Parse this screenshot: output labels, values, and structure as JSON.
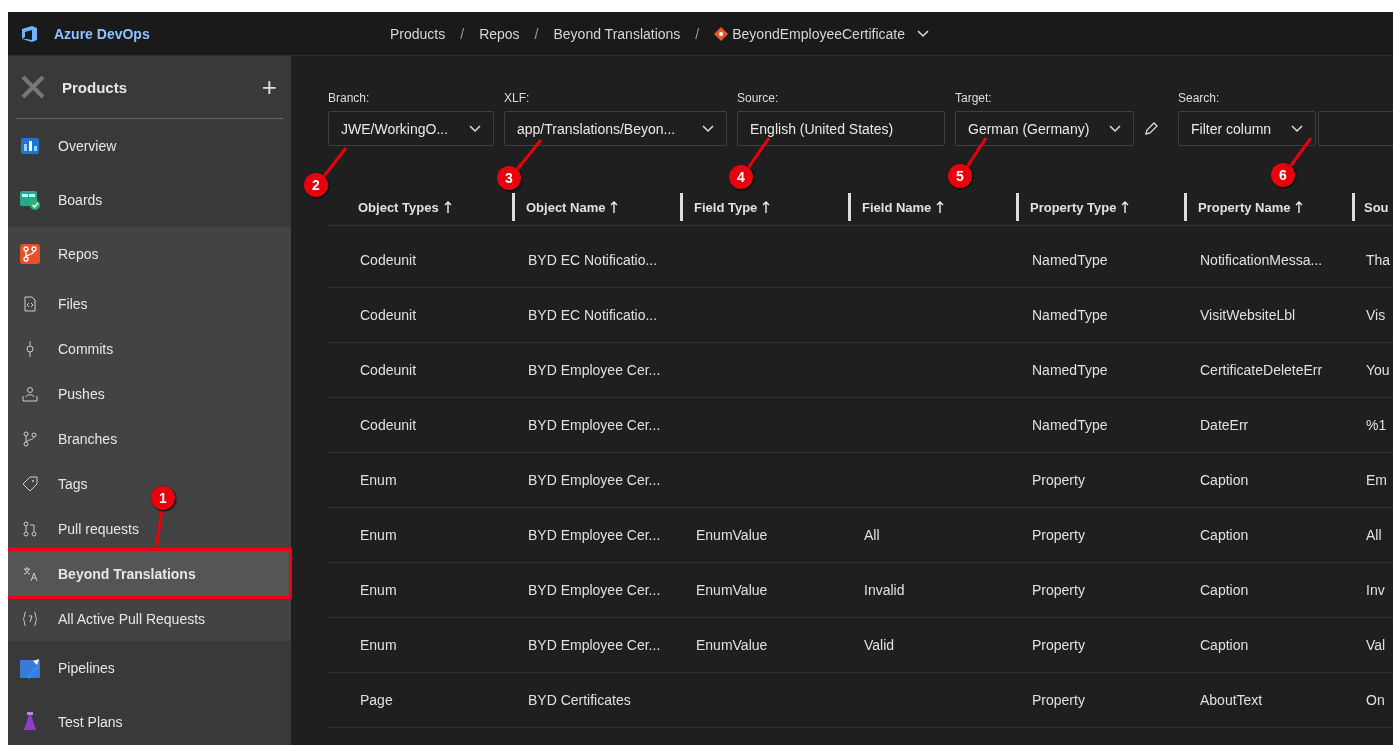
{
  "topbar": {
    "product": "Azure DevOps",
    "separator": "/",
    "breadcrumb": [
      {
        "label": "Products",
        "kind": "text"
      },
      {
        "label": "Repos",
        "kind": "text"
      },
      {
        "label": "Beyond Translations",
        "kind": "text"
      },
      {
        "label": "BeyondEmployeeCertificate",
        "kind": "repo"
      }
    ]
  },
  "sidebar": {
    "project": "Products",
    "add_label": "+",
    "items": [
      {
        "label": "Overview",
        "selected": false
      },
      {
        "label": "Boards",
        "selected": false
      },
      {
        "label": "Repos",
        "selected": false,
        "expanded": true,
        "children": [
          {
            "label": "Files",
            "selected": false,
            "highlighted": false
          },
          {
            "label": "Commits",
            "selected": false,
            "highlighted": false
          },
          {
            "label": "Pushes",
            "selected": false,
            "highlighted": false
          },
          {
            "label": "Branches",
            "selected": false,
            "highlighted": false
          },
          {
            "label": "Tags",
            "selected": false,
            "highlighted": false
          },
          {
            "label": "Pull requests",
            "selected": false,
            "highlighted": false
          },
          {
            "label": "Beyond Translations",
            "selected": true,
            "highlighted": true
          },
          {
            "label": "All Active Pull Requests",
            "selected": false,
            "highlighted": false
          }
        ]
      },
      {
        "label": "Pipelines",
        "selected": false
      },
      {
        "label": "Test Plans",
        "selected": false
      }
    ]
  },
  "filters": [
    {
      "label": "Branch:",
      "kind": "dropdown",
      "value": "JWE/WorkingO..."
    },
    {
      "label": "XLF:",
      "kind": "dropdown",
      "value": "app/Translations/Beyon..."
    },
    {
      "label": "Source:",
      "kind": "text",
      "value": "English (United States)"
    },
    {
      "label": "Target:",
      "kind": "dropdown",
      "value": "German (Germany)",
      "editable": true
    },
    {
      "label": "Search:",
      "kind": "dropdown",
      "value": "Filter column",
      "search_box": true
    }
  ],
  "table": {
    "columns": [
      {
        "label": "Object Types",
        "sorted": true
      },
      {
        "label": "Object Name",
        "sorted": true
      },
      {
        "label": "Field Type",
        "sorted": true
      },
      {
        "label": "Field Name",
        "sorted": true
      },
      {
        "label": "Property Type",
        "sorted": true
      },
      {
        "label": "Property Name",
        "sorted": true
      },
      {
        "label": "Sou"
      }
    ],
    "rows": [
      {
        "object_type": "Codeunit",
        "object_name": "BYD EC Notificatio...",
        "property_type": "NamedType",
        "property_name": "NotificationMessa...",
        "column_7": "Tha"
      },
      {
        "object_type": "Codeunit",
        "object_name": "BYD EC Notificatio...",
        "property_type": "NamedType",
        "property_name": "VisitWebsiteLbl",
        "column_7": "Vis"
      },
      {
        "object_type": "Codeunit",
        "object_name": "BYD Employee Cer...",
        "property_type": "NamedType",
        "property_name": "CertificateDeleteErr",
        "column_7": "You"
      },
      {
        "object_type": "Codeunit",
        "object_name": "BYD Employee Cer...",
        "property_type": "NamedType",
        "property_name": "DateErr",
        "column_7": "%1"
      },
      {
        "object_type": "Enum",
        "object_name": "BYD Employee Cer...",
        "property_type": "Property",
        "property_name": "Caption",
        "column_7": "Em"
      },
      {
        "object_type": "Enum",
        "object_name": "BYD Employee Cer...",
        "field_type": "EnumValue",
        "field_name": "All",
        "property_type": "Property",
        "property_name": "Caption",
        "column_7": "All"
      },
      {
        "object_type": "Enum",
        "object_name": "BYD Employee Cer...",
        "field_type": "EnumValue",
        "field_name": "Invalid",
        "property_type": "Property",
        "property_name": "Caption",
        "column_7": "Inv"
      },
      {
        "object_type": "Enum",
        "object_name": "BYD Employee Cer...",
        "field_type": "EnumValue",
        "field_name": "Valid",
        "property_type": "Property",
        "property_name": "Caption",
        "column_7": "Val"
      },
      {
        "object_type": "Page",
        "object_name": "BYD Certificates",
        "property_type": "Property",
        "property_name": "AboutText",
        "column_7": "On"
      }
    ]
  },
  "callouts": [
    {
      "number": "1"
    },
    {
      "number": "2"
    },
    {
      "number": "3"
    },
    {
      "number": "4"
    },
    {
      "number": "5"
    },
    {
      "number": "6"
    }
  ]
}
